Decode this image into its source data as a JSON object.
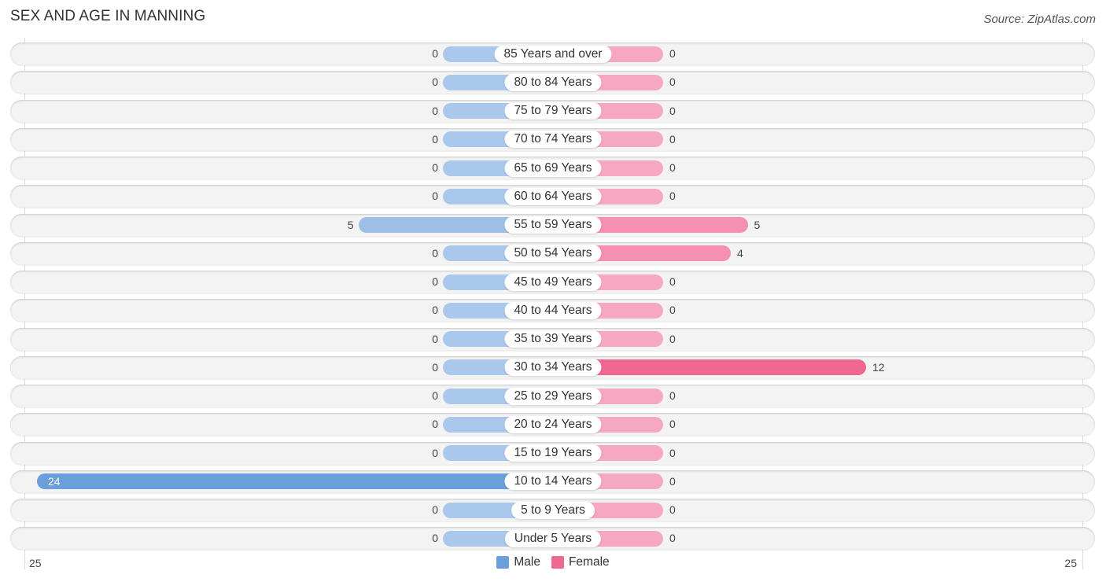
{
  "title": "SEX AND AGE IN MANNING",
  "source": "Source: ZipAtlas.com",
  "colors": {
    "male_zero": "#aac8ec",
    "male_small": "#9dbfe6",
    "male_large": "#6a9fdc",
    "female_zero": "#f6a8c2",
    "female_small": "#f590b0",
    "female_large": "#f06890"
  },
  "chart_data": {
    "type": "bar",
    "orientation": "horizontal-diverging",
    "title": "SEX AND AGE IN MANNING",
    "categories": [
      "85 Years and over",
      "80 to 84 Years",
      "75 to 79 Years",
      "70 to 74 Years",
      "65 to 69 Years",
      "60 to 64 Years",
      "55 to 59 Years",
      "50 to 54 Years",
      "45 to 49 Years",
      "40 to 44 Years",
      "35 to 39 Years",
      "30 to 34 Years",
      "25 to 29 Years",
      "20 to 24 Years",
      "15 to 19 Years",
      "10 to 14 Years",
      "5 to 9 Years",
      "Under 5 Years"
    ],
    "series": [
      {
        "name": "Male",
        "values": [
          0,
          0,
          0,
          0,
          0,
          0,
          5,
          0,
          0,
          0,
          0,
          0,
          0,
          0,
          0,
          24,
          0,
          0
        ]
      },
      {
        "name": "Female",
        "values": [
          0,
          0,
          0,
          0,
          0,
          0,
          5,
          4,
          0,
          0,
          0,
          12,
          0,
          0,
          0,
          0,
          0,
          0
        ]
      }
    ],
    "axis": {
      "left_label": "25",
      "right_label": "25",
      "range": [
        -25,
        25
      ]
    },
    "legend": {
      "placement": "bottom-center",
      "entries": [
        "Male",
        "Female"
      ]
    },
    "grid": false
  }
}
